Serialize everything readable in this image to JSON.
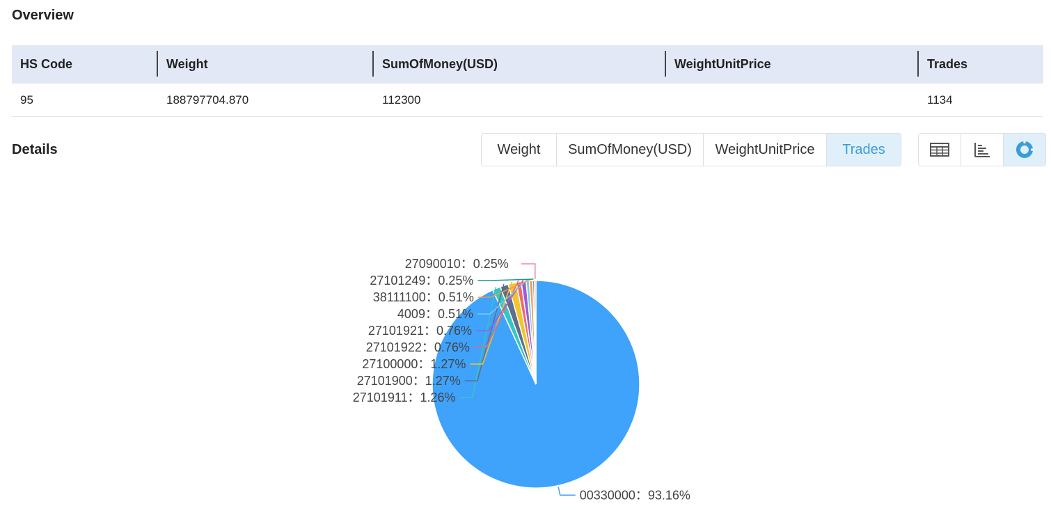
{
  "overview": {
    "title": "Overview",
    "headers": [
      "HS Code",
      "Weight",
      "SumOfMoney(USD)",
      "WeightUnitPrice",
      "Trades"
    ],
    "row": [
      "95",
      "188797704.870",
      "112300",
      "",
      "1134"
    ]
  },
  "details": {
    "title": "Details",
    "tabs": [
      "Weight",
      "SumOfMoney(USD)",
      "WeightUnitPrice",
      "Trades"
    ],
    "active_tab": "Trades",
    "view_buttons": [
      "table-view-icon",
      "bar-chart-icon",
      "pie-chart-icon"
    ],
    "active_view": "pie-chart-icon"
  },
  "colors": {
    "accent": "#3b9dd8",
    "header_bg": "#e3e8f6",
    "active_bg": "#dff0fa"
  },
  "chart_data": {
    "type": "pie",
    "slices": [
      {
        "label": "00330000",
        "value": 93.16,
        "color": "#3fa2fb"
      },
      {
        "label": "27101911",
        "value": 1.26,
        "color": "#35c6c3"
      },
      {
        "label": "27101900",
        "value": 1.27,
        "color": "#5d6e8e"
      },
      {
        "label": "27100000",
        "value": 1.27,
        "color": "#f2c530"
      },
      {
        "label": "27101922",
        "value": 0.76,
        "color": "#ee6b6b"
      },
      {
        "label": "27101921",
        "value": 0.76,
        "color": "#9b5dd6"
      },
      {
        "label": "4009",
        "value": 0.51,
        "color": "#7ccbea"
      },
      {
        "label": "38111100",
        "value": 0.51,
        "color": "#f89845"
      },
      {
        "label": "27101249",
        "value": 0.25,
        "color": "#139b8e"
      },
      {
        "label": "27090010",
        "value": 0.25,
        "color": "#f185ad"
      }
    ],
    "label_format": "{label}：{value}%"
  }
}
